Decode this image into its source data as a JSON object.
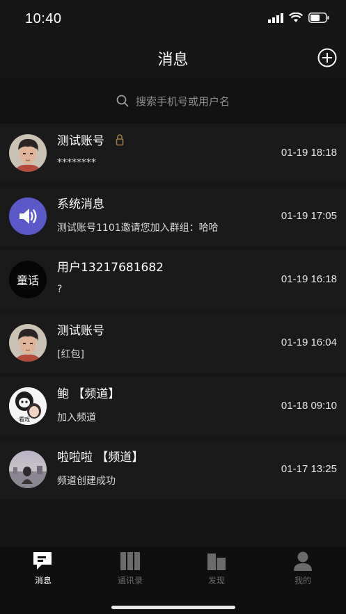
{
  "status": {
    "time": "10:40"
  },
  "nav": {
    "title": "消息"
  },
  "search": {
    "placeholder": "搜索手机号或用户名"
  },
  "conversations": [
    {
      "name": "测试账号",
      "preview": "********",
      "time": "01-19 18:18",
      "avatar": "cartoon-man-avatar",
      "locked": true
    },
    {
      "name": "系统消息",
      "preview": "测试账号1101邀请您加入群组：哈哈",
      "time": "01-19 17:05",
      "avatar": "speaker-icon"
    },
    {
      "name": "用户13217681682",
      "preview": "?",
      "time": "01-19 16:18",
      "avatar": "text-avatar",
      "avatar_text": "童话"
    },
    {
      "name": "测试账号",
      "preview": "[红包]",
      "time": "01-19 16:04",
      "avatar": "cartoon-man-avatar"
    },
    {
      "name": "鲍 【频道】",
      "preview": "加入频道",
      "time": "01-18 09:10",
      "avatar": "meme-avatar",
      "avatar_text": "看戏"
    },
    {
      "name": "啦啦啦 【频道】",
      "preview": "频道创建成功",
      "time": "01-17 13:25",
      "avatar": "photo-avatar"
    }
  ],
  "tabs": [
    {
      "label": "消息",
      "icon": "chat-icon",
      "active": true
    },
    {
      "label": "通讯录",
      "icon": "contacts-icon",
      "active": false
    },
    {
      "label": "发现",
      "icon": "buildings-icon",
      "active": false
    },
    {
      "label": "我的",
      "icon": "user-icon",
      "active": false
    }
  ],
  "colors": {
    "background": "#161616",
    "row": "#1a1a1a",
    "accent_purple": "#5b58c9",
    "inactive_tab": "#6b6b6b"
  }
}
